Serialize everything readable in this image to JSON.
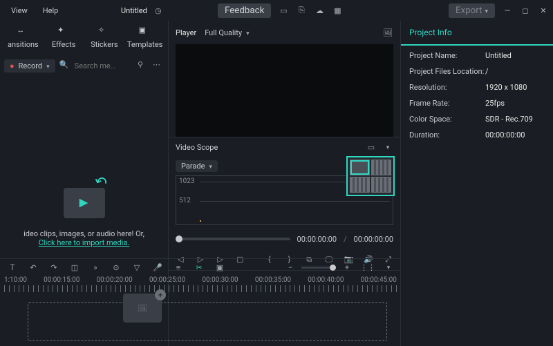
{
  "menu": {
    "view": "View",
    "help": "Help"
  },
  "doc_title": "Untitled",
  "feedback": "Feedback",
  "export": "Export",
  "tool_tabs": {
    "transitions": "ansitions",
    "effects": "Effects",
    "stickers": "Stickers",
    "templates": "Templates"
  },
  "record_label": "Record",
  "search_placeholder": "Search me...",
  "import_hint": "ideo clips, images, or audio here! Or,",
  "import_link": "Click here to import media.",
  "player": {
    "label": "Player",
    "quality": "Full Quality"
  },
  "scope": {
    "title": "Video Scope",
    "mode": "Parade",
    "y_1023": "1023",
    "y_512": "512"
  },
  "time": {
    "cur": "00:00:00:00",
    "slash": "/",
    "dur": "00:00:00:00"
  },
  "project_info": {
    "header": "Project Info",
    "rows": [
      {
        "k": "Project Name:",
        "v": "Untitled"
      },
      {
        "k": "Project Files Location:",
        "v": "/"
      },
      {
        "k": "Resolution:",
        "v": "1920 x 1080"
      },
      {
        "k": "Frame Rate:",
        "v": "25fps"
      },
      {
        "k": "Color Space:",
        "v": "SDR - Rec.709"
      },
      {
        "k": "Duration:",
        "v": "00:00:00:00"
      }
    ]
  },
  "ruler": [
    "1:10:00",
    "00:00:15:00",
    "00:00:20:00",
    "00:00:25:00",
    "00:00:30:00",
    "00:00:35:00",
    "00:00:40:00",
    "00:00:45:00"
  ]
}
